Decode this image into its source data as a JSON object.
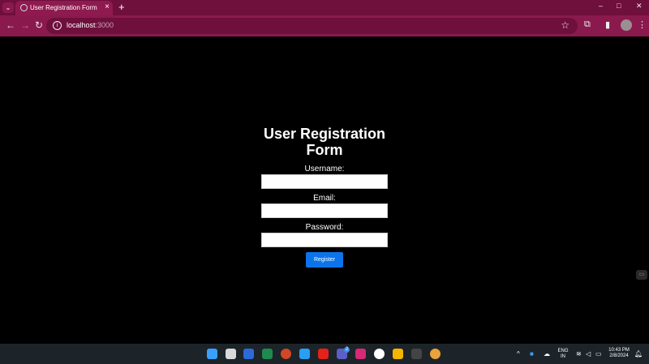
{
  "browser": {
    "tab_title": "User Registration Form",
    "tab_close": "×",
    "new_tab": "+",
    "url_host": "localhost",
    "url_port": ":3000",
    "window_controls": [
      "–",
      "□",
      "✕"
    ],
    "accent_color": "#8a1a4e"
  },
  "form": {
    "title": "User Registration Form",
    "username_label": "Username:",
    "email_label": "Email:",
    "password_label": "Password:",
    "username_value": "",
    "email_value": "",
    "password_value": "",
    "register_label": "Register",
    "button_color": "#0b74ea"
  },
  "taskbar": {
    "language": "ENG",
    "region": "IN",
    "time": "10:43 PM",
    "date": "2/8/2024",
    "badge_count": "2",
    "apps": [
      "windows-start-icon",
      "file-explorer-icon",
      "word-icon",
      "excel-icon",
      "powerpoint-icon",
      "vscode-icon",
      "youtube-icon",
      "teams-icon",
      "instagram-icon",
      "github-icon",
      "files-icon",
      "terminal-icon",
      "chrome-icon"
    ]
  }
}
